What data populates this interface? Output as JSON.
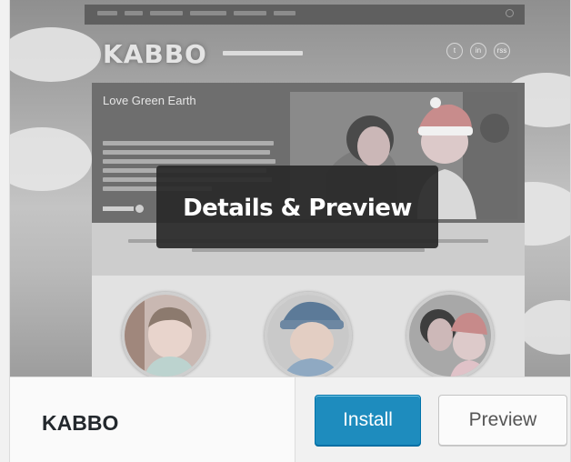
{
  "theme": {
    "name": "KABBO",
    "overlay_label": "Details & Preview"
  },
  "actions": {
    "install_label": "Install",
    "preview_label": "Preview"
  },
  "screenshot": {
    "logo_text": "KABBO",
    "hero_title": "Love Green Earth",
    "social_icons": [
      "t",
      "in",
      "rss"
    ]
  },
  "colors": {
    "install_button": "#1e8cbe",
    "overlay": "#282828",
    "footer_bg": "#fafafa"
  }
}
